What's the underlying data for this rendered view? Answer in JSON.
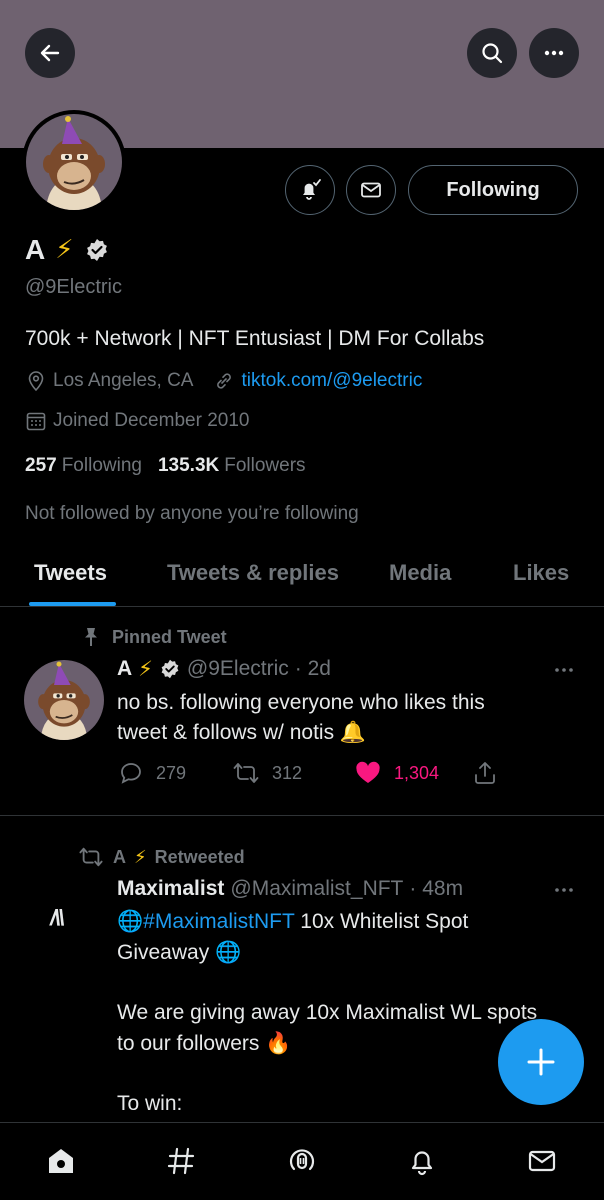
{
  "header": {
    "back_icon": "arrow-left-icon",
    "search_icon": "search-icon",
    "more_icon": "more-horizontal-icon",
    "banner_color": "#6f6270"
  },
  "profile": {
    "display_name": "A",
    "name_emoji": "⚡",
    "handle": "@9Electric",
    "bio": "700k + Network | NFT Entusiast | DM For Collabs",
    "location": "Los Angeles, CA",
    "website": "tiktok.com/@9electric",
    "joined": "Joined December 2010",
    "following_count": "257",
    "following_label": "Following",
    "followers_count": "135.3K",
    "followers_label": "Followers",
    "followed_by_note": "Not followed by anyone you’re following",
    "follow_button_label": "Following"
  },
  "tabs": [
    {
      "label": "Tweets",
      "active": true
    },
    {
      "label": "Tweets & replies",
      "active": false
    },
    {
      "label": "Media",
      "active": false
    },
    {
      "label": "Likes",
      "active": false
    }
  ],
  "pinned_tweet": {
    "context_label": "Pinned Tweet",
    "author_name": "A",
    "author_emoji": "⚡",
    "author_handle": "@9Electric",
    "time": "· 2d",
    "text_line1": "no bs. following everyone who likes this",
    "text_line2": "tweet & follows w/ notis 🔔",
    "replies": "279",
    "retweets": "312",
    "likes": "1,304"
  },
  "retweeted_tweet": {
    "context_name": "A",
    "context_emoji": "⚡",
    "context_label": "Retweeted",
    "author_name": "Maximalist",
    "author_handle": "@Maximalist_NFT",
    "time": "· 48m",
    "logo_text": "/\\\\",
    "globe": "🌐",
    "hashtag": "#MaximalistNFT",
    "line1_rest": " 10x Whitelist Spot",
    "line2": "Giveaway",
    "line3": "We are giving away 10x Maximalist WL spots",
    "line4": "to our followers",
    "fire": "🔥",
    "line5": "To win:"
  },
  "colors": {
    "accent": "#1d9bf0",
    "like": "#f91880",
    "muted": "#71767b"
  },
  "bottom_nav": [
    "home-icon",
    "explore-hashtag-icon",
    "spaces-icon",
    "notifications-icon",
    "messages-icon"
  ]
}
